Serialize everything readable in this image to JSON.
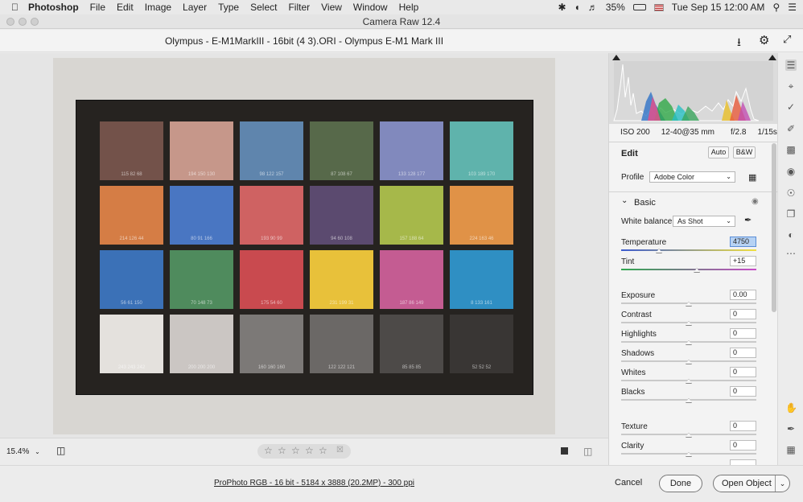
{
  "menubar": {
    "app": "Photoshop",
    "items": [
      "File",
      "Edit",
      "Image",
      "Layer",
      "Type",
      "Select",
      "Filter",
      "View",
      "Window",
      "Help"
    ],
    "battery": "35%",
    "datetime": "Tue Sep 15  12:00 AM"
  },
  "window": {
    "title": "Camera Raw 12.4"
  },
  "subbar": {
    "filename": "Olympus - E-M1MarkIII - 16bit (4 3).ORI  -  Olympus E-M1 Mark III"
  },
  "chart_patches": [
    {
      "label": "115 82 68",
      "color": "#73524a"
    },
    {
      "label": "194 150 130",
      "color": "#c6978a"
    },
    {
      "label": "98 122 157",
      "color": "#5f85ad"
    },
    {
      "label": "87 108 67",
      "color": "#57694a"
    },
    {
      "label": "133 128 177",
      "color": "#8189bd"
    },
    {
      "label": "103 189 170",
      "color": "#5fb3ac"
    },
    {
      "label": "214 126 44",
      "color": "#d57d45"
    },
    {
      "label": "80 91 166",
      "color": "#4976c2"
    },
    {
      "label": "193 90 99",
      "color": "#cf6262"
    },
    {
      "label": "94 60 108",
      "color": "#5b4a6f"
    },
    {
      "label": "157 188 64",
      "color": "#a6b84a"
    },
    {
      "label": "224 163 46",
      "color": "#e09247"
    },
    {
      "label": "56 61 150",
      "color": "#3b71b7"
    },
    {
      "label": "70 148 73",
      "color": "#4f8b5d"
    },
    {
      "label": "175 54 60",
      "color": "#c94a4f"
    },
    {
      "label": "231 199 31",
      "color": "#e8c13a"
    },
    {
      "label": "187 86 149",
      "color": "#c45c92"
    },
    {
      "label": "8 133 161",
      "color": "#2f8fc3"
    },
    {
      "label": "243 243 242",
      "color": "#e4e1dd"
    },
    {
      "label": "200 200 200",
      "color": "#cbc6c3"
    },
    {
      "label": "160 160 160",
      "color": "#7c7977"
    },
    {
      "label": "122 122 121",
      "color": "#6b6866"
    },
    {
      "label": "85 85 85",
      "color": "#4d4a48"
    },
    {
      "label": "52 52 52",
      "color": "#393634"
    }
  ],
  "camera_info": {
    "iso": "ISO 200",
    "lens": "12-40@35 mm",
    "aperture": "f/2.8",
    "shutter": "1/15s"
  },
  "edit": {
    "title": "Edit",
    "auto": "Auto",
    "bw": "B&W",
    "profile_label": "Profile",
    "profile_value": "Adobe Color",
    "basic_label": "Basic",
    "wb_label": "White balance",
    "wb_value": "As Shot",
    "sliders": [
      {
        "label": "Temperature",
        "value": "4750",
        "pos": 0.28
      },
      {
        "label": "Tint",
        "value": "+15",
        "pos": 0.56
      },
      {
        "label": "Exposure",
        "value": "0.00",
        "pos": 0.5
      },
      {
        "label": "Contrast",
        "value": "0",
        "pos": 0.5
      },
      {
        "label": "Highlights",
        "value": "0",
        "pos": 0.5
      },
      {
        "label": "Shadows",
        "value": "0",
        "pos": 0.5
      },
      {
        "label": "Whites",
        "value": "0",
        "pos": 0.5
      },
      {
        "label": "Blacks",
        "value": "0",
        "pos": 0.5
      },
      {
        "label": "Texture",
        "value": "0",
        "pos": 0.5
      },
      {
        "label": "Clarity",
        "value": "0",
        "pos": 0.5
      }
    ]
  },
  "footer": {
    "zoom": "15.4%",
    "workflow": "ProPhoto RGB - 16 bit - 5184 x 3888 (20.2MP) - 300 ppi",
    "cancel": "Cancel",
    "done": "Done",
    "open": "Open Object"
  },
  "icons": {
    "apple": "apple-icon",
    "bluetooth": "bluetooth-icon",
    "wifi": "wifi-icon",
    "volume": "volume-icon",
    "search": "search-icon",
    "menu": "menu-icon"
  }
}
